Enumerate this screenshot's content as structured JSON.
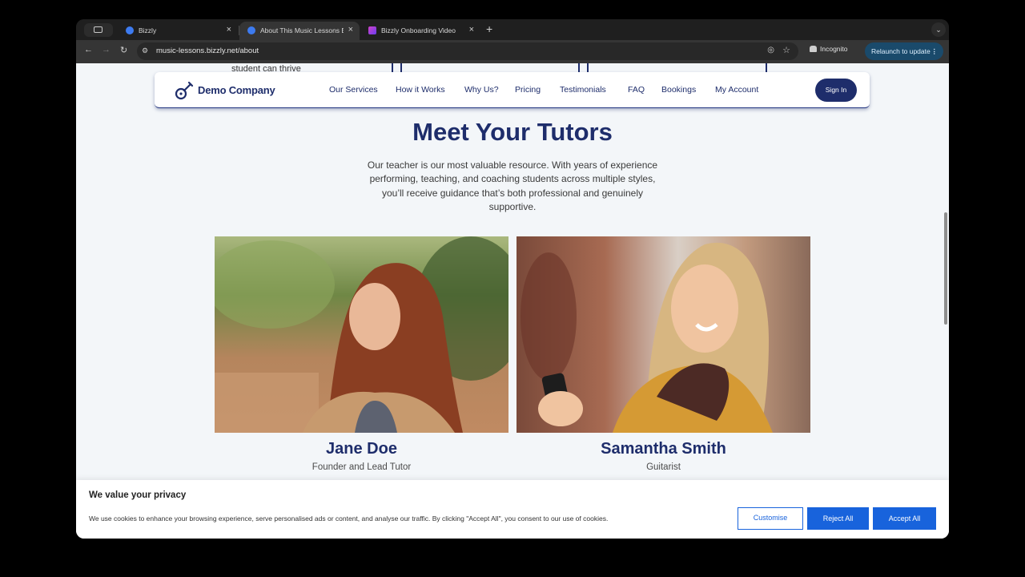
{
  "browser": {
    "tabs": [
      {
        "title": "Bizzly",
        "active": false
      },
      {
        "title": "About This Music Lessons Bu",
        "active": true
      },
      {
        "title": "Bizzly Onboarding Video",
        "active": false
      }
    ],
    "url": "music-lessons.bizzly.net/about",
    "incognito_label": "Incognito",
    "relaunch_label": "Relaunch to update"
  },
  "peek_text": "student can thrive",
  "header": {
    "logo_text": "Demo Company",
    "nav": [
      "Our Services",
      "How it Works",
      "Why Us?",
      "Pricing",
      "Testimonials",
      "FAQ",
      "Bookings",
      "My Account"
    ],
    "sign_in_label": "Sign In"
  },
  "tutors_section": {
    "title": "Meet Your Tutors",
    "description": "Our teacher is our most valuable resource. With years of experience performing, teaching, and coaching students across multiple styles, you’ll receive guidance that’s both professional and genuinely supportive.",
    "tutors": [
      {
        "name": "Jane Doe",
        "role": "Founder and Lead Tutor"
      },
      {
        "name": "Samantha Smith",
        "role": "Guitarist"
      }
    ]
  },
  "cookie_banner": {
    "title": "We value your privacy",
    "text": "We use cookies to enhance your browsing experience, serve personalised ads or content, and analyse our traffic. By clicking \"Accept All\", you consent to our use of cookies.",
    "customise_label": "Customise",
    "reject_label": "Reject All",
    "accept_label": "Accept All"
  },
  "colors": {
    "brand_navy": "#1e2d6b",
    "cookie_blue": "#1863dc",
    "page_bg": "#f3f6f9"
  }
}
